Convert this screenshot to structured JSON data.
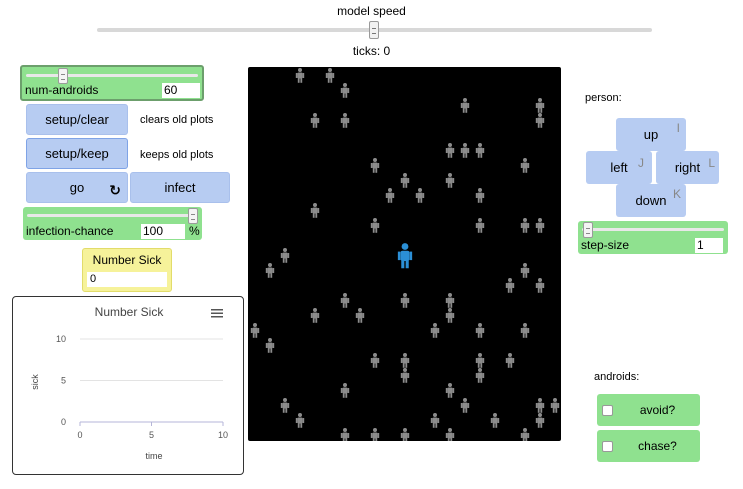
{
  "speed": {
    "label": "model speed",
    "ticks_text": "ticks: 0"
  },
  "num_androids": {
    "label": "num-androids",
    "value": "60"
  },
  "buttons": {
    "setup_clear": "setup/clear",
    "setup_keep": "setup/keep",
    "go": "go",
    "go_forever_icon": "↻",
    "infect": "infect"
  },
  "notes": {
    "clear": "clears old plots",
    "keep": "keeps old plots"
  },
  "infection_chance": {
    "label": "infection-chance",
    "value": "100",
    "unit": "%"
  },
  "monitor": {
    "label": "Number Sick",
    "value": "0"
  },
  "plot": {
    "menu_icon": "hamburger-menu-icon",
    "chart_data": {
      "type": "line",
      "title": "Number Sick",
      "xlabel": "time",
      "ylabel": "sick",
      "xlim": [
        0,
        10
      ],
      "ylim": [
        0,
        10
      ],
      "xticks": [
        "0",
        "5",
        "10"
      ],
      "yticks": [
        "0",
        "5",
        "10"
      ],
      "series": [
        {
          "values": []
        }
      ],
      "grid": true
    }
  },
  "person": {
    "label": "person:",
    "up": "up",
    "up_key": "I",
    "left": "left",
    "left_key": "J",
    "right": "right",
    "right_key": "L",
    "down": "down",
    "down_key": "K"
  },
  "step_size": {
    "label": "step-size",
    "value": "1"
  },
  "androids": {
    "label": "androids:",
    "avoid": "avoid?",
    "chase": "chase?"
  },
  "view": {
    "background": "#000000",
    "android_color": "#8c8c8c",
    "player_color": "#2b8fd6"
  },
  "colors": {
    "slider_green": "#8fe18f",
    "button_blue": "#b7ccf2",
    "monitor_yellow": "#f6f29a"
  }
}
